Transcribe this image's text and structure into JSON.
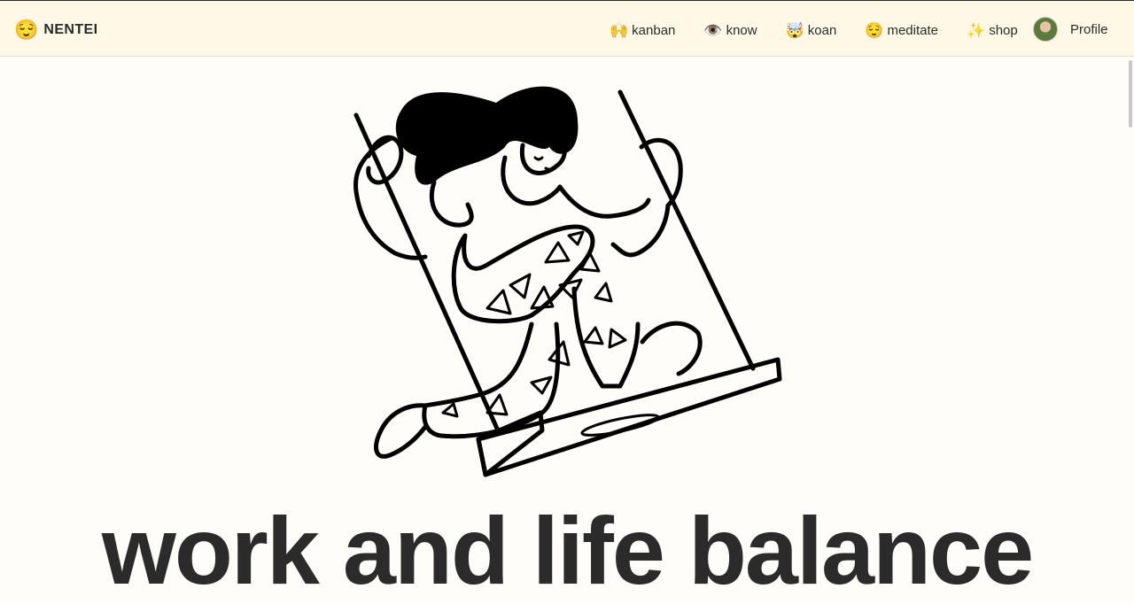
{
  "header": {
    "brand": {
      "emoji": "😌",
      "name": "NENTEI"
    },
    "nav": [
      {
        "emoji": "🙌",
        "label": "kanban"
      },
      {
        "emoji": "👁️",
        "label": "know"
      },
      {
        "emoji": "🤯",
        "label": "koan"
      },
      {
        "emoji": "😌",
        "label": "meditate"
      },
      {
        "emoji": "✨",
        "label": "shop"
      }
    ],
    "profile": {
      "label": "Profile"
    }
  },
  "hero": {
    "title": "work and life balance"
  }
}
